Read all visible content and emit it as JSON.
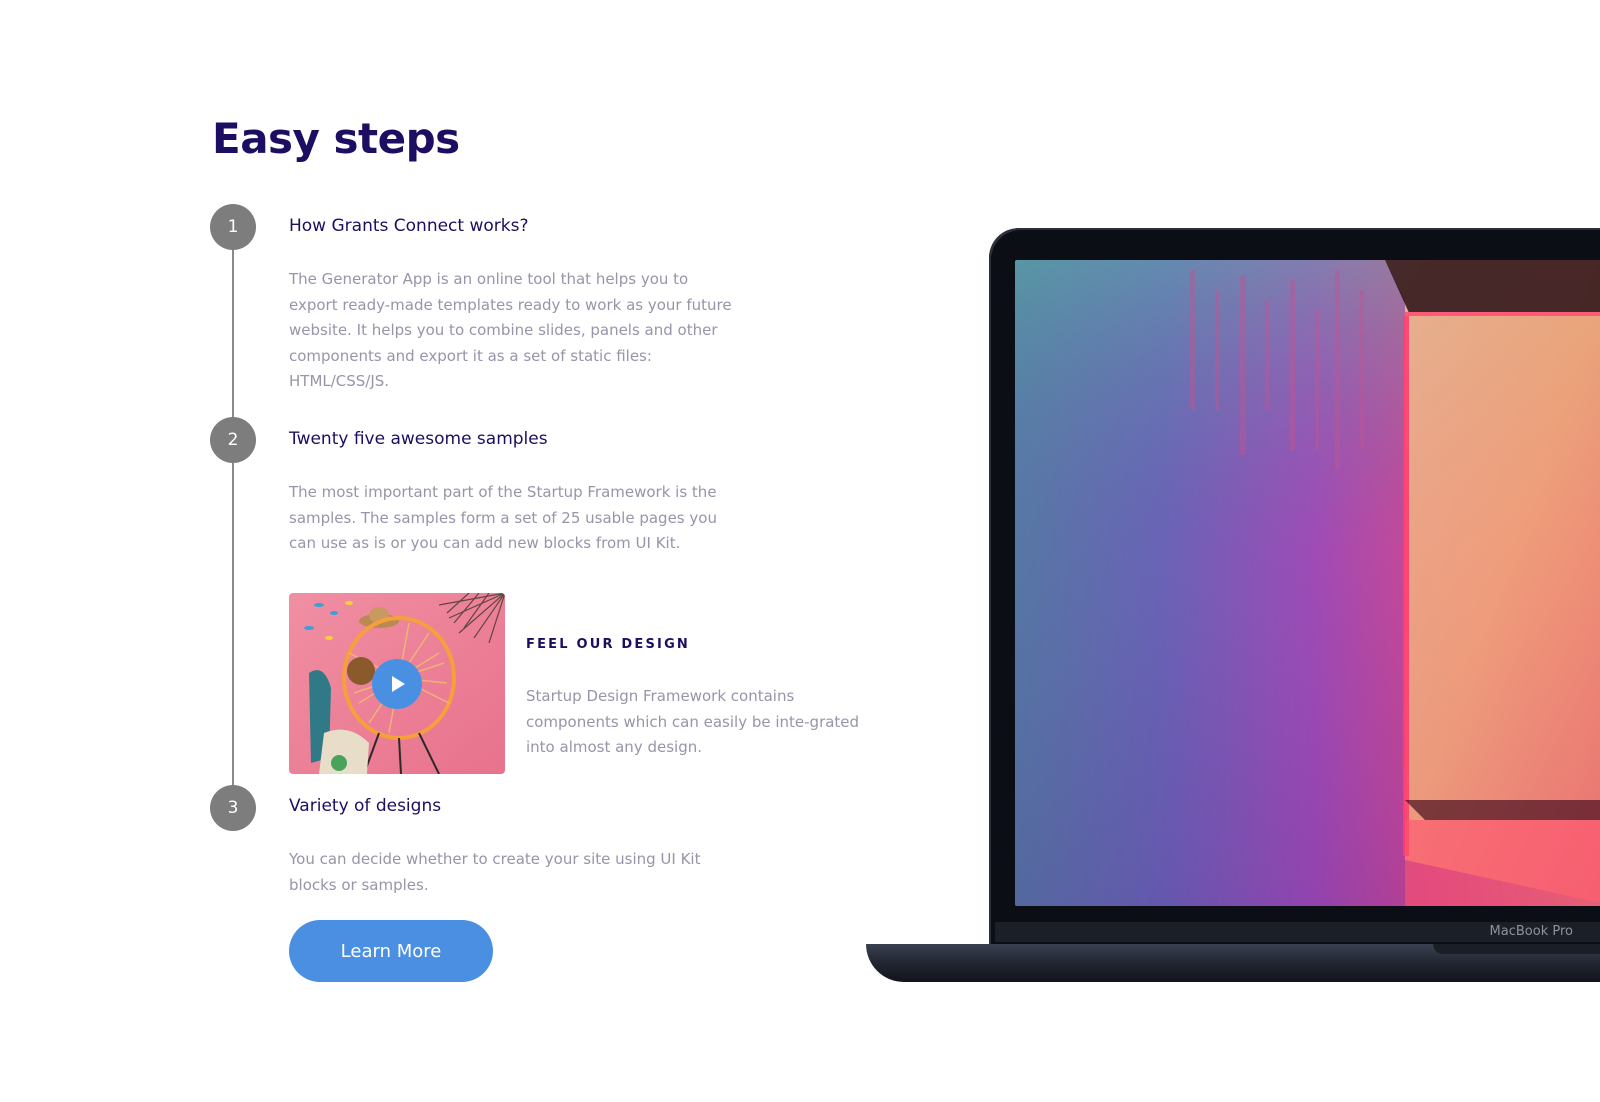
{
  "section": {
    "title": "Easy steps"
  },
  "steps": [
    {
      "number": "1",
      "title": "How Grants Connect works?",
      "text": "The Generator App is an online tool that helps you to export ready-made templates ready to work as your future website. It helps you to combine slides, panels and other components and export it as a set of static files: HTML/CSS/JS."
    },
    {
      "number": "2",
      "title": "Twenty five awesome samples",
      "text": "The most important part of the Startup Framework is the samples. The samples form a set of 25 usable pages you can use as is or you can add new blocks from UI Kit."
    },
    {
      "number": "3",
      "title": "Variety of designs",
      "text": "You can decide whether to create your site using UI Kit blocks or samples."
    }
  ],
  "feature": {
    "title": "FEEL OUR DESIGN",
    "text": "Startup Design Framework contains components which can easily be inte-grated into almost any design."
  },
  "cta": {
    "label": "Learn More"
  },
  "laptop": {
    "brand": "MacBook Pro"
  },
  "colors": {
    "heading": "#1e0e62",
    "body_text": "#9795a8",
    "accent": "#4a90e2",
    "step_circle": "#7d7d7d"
  }
}
